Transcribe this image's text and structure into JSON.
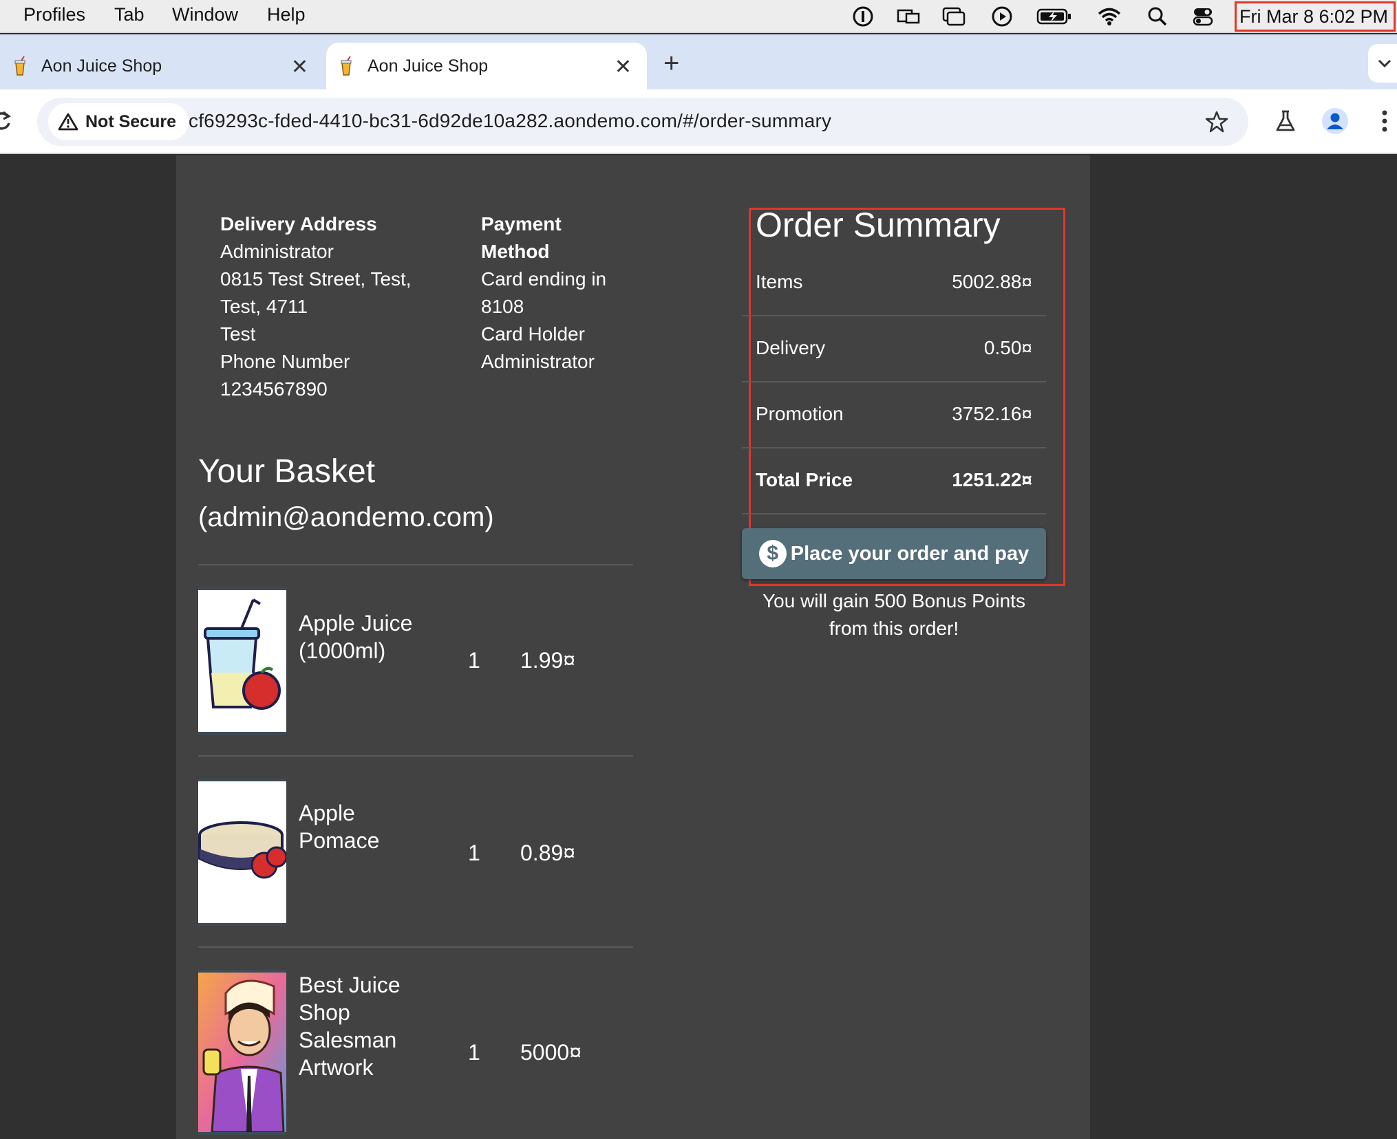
{
  "menubar": {
    "items": [
      "Profiles",
      "Tab",
      "Window",
      "Help"
    ],
    "clock": "Fri Mar 8  6:02 PM"
  },
  "tabs": [
    {
      "title": "Aon Juice Shop",
      "close": "✕"
    },
    {
      "title": "Aon Juice Shop",
      "close": "✕"
    }
  ],
  "new_tab": "+",
  "address_bar": {
    "security": "Not Secure",
    "url": "cf69293c-fded-4410-bc31-6d92de10a282.aondemo.com/#/order-summary"
  },
  "delivery": {
    "label": "Delivery Address",
    "lines": [
      "Administrator",
      "0815 Test Street, Test,",
      "Test, 4711",
      "Test",
      "Phone Number",
      "1234567890"
    ]
  },
  "payment": {
    "label_line1": "Payment",
    "label_line2": "Method",
    "lines": [
      "Card ending in",
      "8108",
      "Card Holder",
      "Administrator"
    ]
  },
  "basket": {
    "title": "Your Basket",
    "subtitle": "(admin@aondemo.com)",
    "items": [
      {
        "name_lines": [
          "Apple Juice",
          "(1000ml)"
        ],
        "quantity": "1",
        "price": "1.99¤"
      },
      {
        "name_lines": [
          "Apple",
          "Pomace"
        ],
        "quantity": "1",
        "price": "0.89¤"
      },
      {
        "name_lines": [
          "Best Juice",
          "Shop",
          "Salesman",
          "Artwork"
        ],
        "quantity": "1",
        "price": "5000¤"
      }
    ]
  },
  "order_summary": {
    "title": "Order Summary",
    "rows": [
      {
        "label": "Items",
        "value": "5002.88¤"
      },
      {
        "label": "Delivery",
        "value": "0.50¤"
      },
      {
        "label": "Promotion",
        "value": "3752.16¤"
      },
      {
        "label": "Total Price",
        "value": "1251.22¤"
      }
    ],
    "button": "Place your order and pay",
    "dollar_symbol": "$",
    "bonus_line1": "You will gain 500 Bonus Points",
    "bonus_line2": "from this order!"
  }
}
